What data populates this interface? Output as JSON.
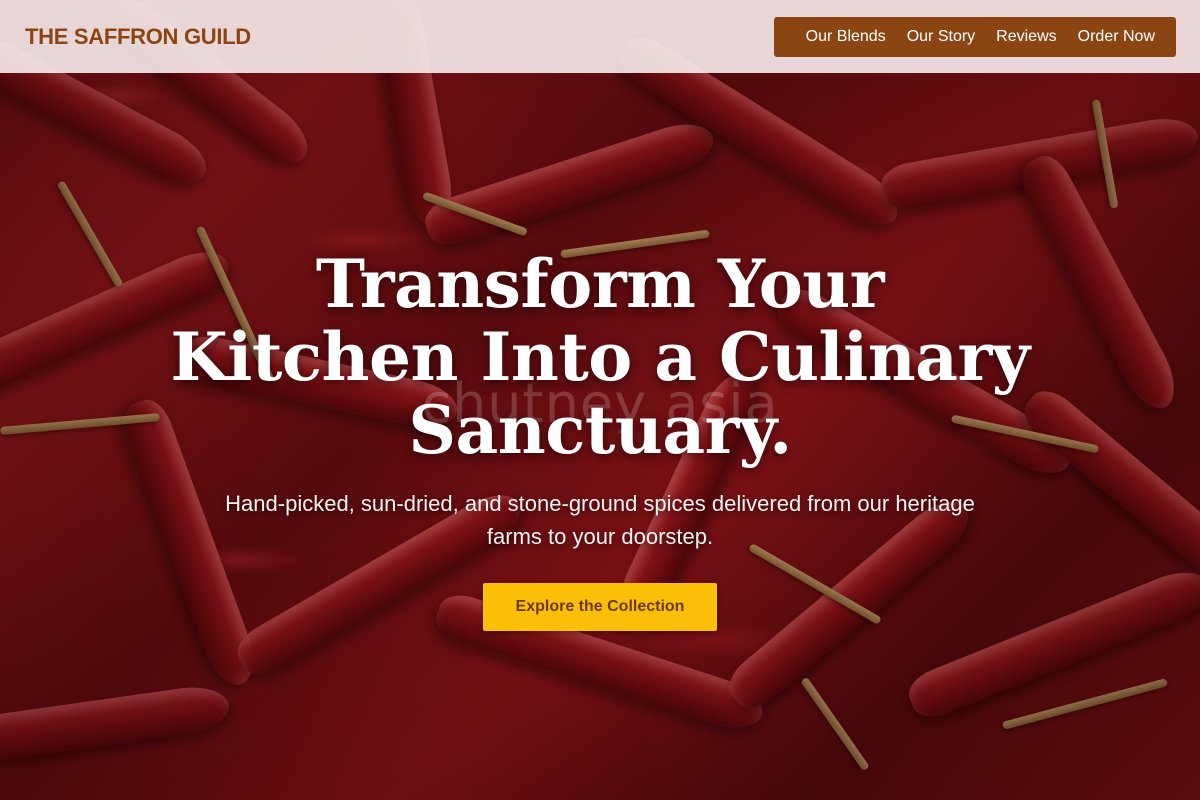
{
  "header": {
    "brand": "THE SAFFRON GUILD",
    "nav": [
      {
        "label": "Our Blends"
      },
      {
        "label": "Our Story"
      },
      {
        "label": "Reviews"
      },
      {
        "label": "Order Now"
      }
    ]
  },
  "hero": {
    "title": "Transform Your Kitchen Into a Culinary Sanctuary.",
    "subtitle": "Hand-picked, sun-dried, and stone-ground spices delivered from our heritage farms to your doorstep.",
    "cta_label": "Explore the Collection",
    "watermark": "chutney asia",
    "background_image": "dried red chilies"
  },
  "colors": {
    "brand": "#8b4513",
    "nav_background": "#8b4513",
    "header_background": "#f8ecec",
    "cta_background": "#fbbf08",
    "cta_text": "#6b3a12",
    "hero_text": "#ffffff"
  }
}
